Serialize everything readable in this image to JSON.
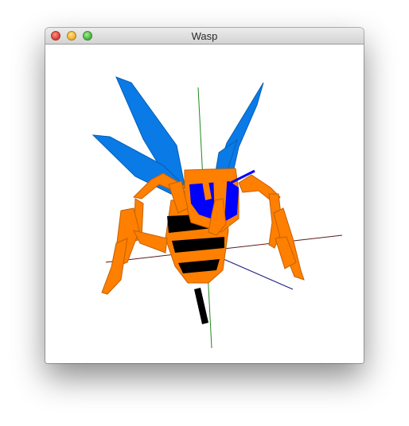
{
  "window": {
    "title": "Wasp"
  },
  "scene": {
    "subject": "wasp",
    "colors": {
      "body_orange": "#ff7f00",
      "stripe_black": "#000000",
      "wing_blue": "#0a7ae6",
      "head_blue": "#0000ff",
      "axis_x": "#5c1a1a",
      "axis_y": "#1f8a1f",
      "axis_z": "#1a1a7a",
      "background": "#ffffff"
    }
  }
}
